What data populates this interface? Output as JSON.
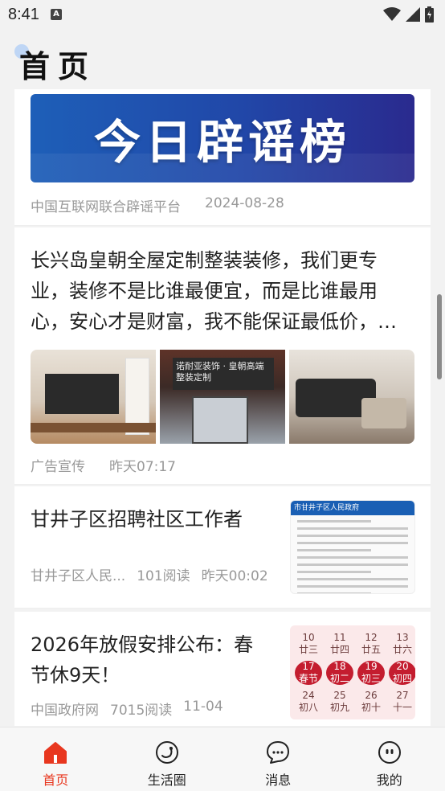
{
  "status_bar": {
    "time": "8:41",
    "notification_icon": "A"
  },
  "page": {
    "title": "首页"
  },
  "feed": [
    {
      "type": "banner",
      "banner_text": "今日辟谣榜",
      "source": "中国互联网联合辟谣平台",
      "date": "2024-08-28"
    },
    {
      "type": "ad",
      "headline": "长兴岛皇朝全屋定制整装装修，我们更专业，装修不是比谁最便宜，而是比谁最用心，安心才是财富，我不能保证最低价，…",
      "sign_text": "诺耐亚装饰 · 皇朝高端整装定制",
      "source": "广告宣传",
      "time": "昨天07:17"
    },
    {
      "type": "article",
      "headline": "甘井子区招聘社区工作者",
      "source": "甘井子区人民...",
      "reads": "101阅读",
      "time": "昨天00:02",
      "thumb_header": "市甘井子区人民政府"
    },
    {
      "type": "article",
      "headline": "2026年放假安排公布：春节休9天！",
      "source": "中国政府网",
      "reads": "7015阅读",
      "time": "11-04",
      "calendar": [
        {
          "day": "10",
          "note": "廿三"
        },
        {
          "day": "11",
          "note": "廿四"
        },
        {
          "day": "12",
          "note": "廿五"
        },
        {
          "day": "13",
          "note": "廿六"
        },
        {
          "day": "17",
          "note": "春节"
        },
        {
          "day": "18",
          "note": "初二"
        },
        {
          "day": "19",
          "note": "初三"
        },
        {
          "day": "20",
          "note": "初四"
        },
        {
          "day": "24",
          "note": "初八"
        },
        {
          "day": "25",
          "note": "初九"
        },
        {
          "day": "26",
          "note": "初十"
        },
        {
          "day": "27",
          "note": "十一"
        }
      ]
    }
  ],
  "tabs": [
    {
      "label": "首页",
      "icon": "home-icon",
      "active": true
    },
    {
      "label": "生活圈",
      "icon": "circle-icon",
      "active": false
    },
    {
      "label": "消息",
      "icon": "chat-icon",
      "active": false
    },
    {
      "label": "我的",
      "icon": "profile-icon",
      "active": false
    }
  ],
  "colors": {
    "accent": "#e8371f",
    "banner_blue": "#2147a8",
    "meta_gray": "#999999"
  }
}
